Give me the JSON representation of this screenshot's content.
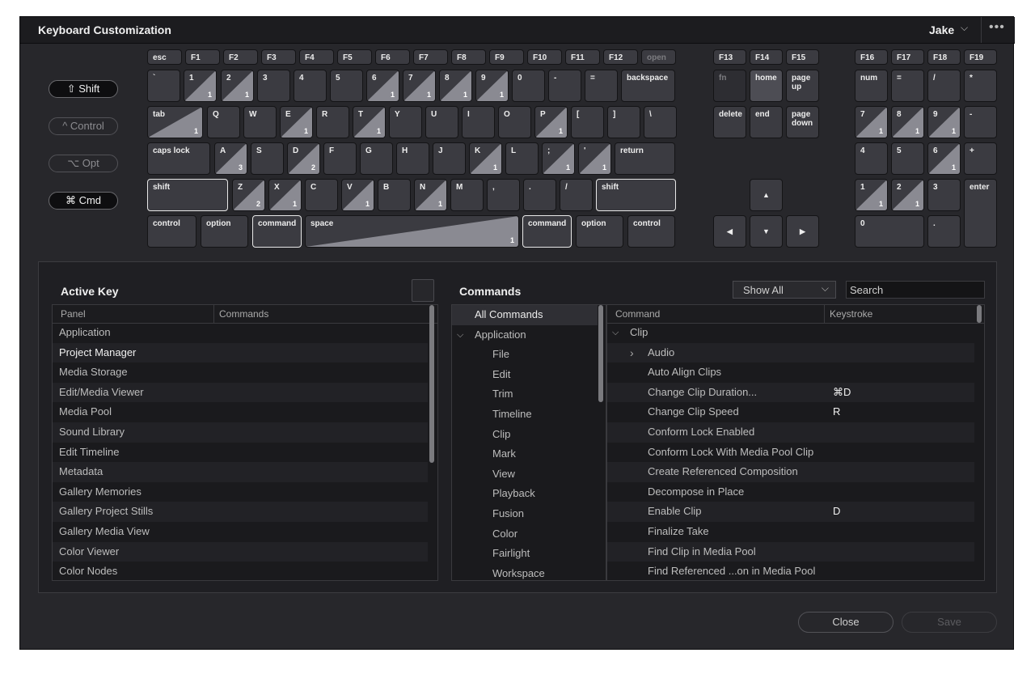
{
  "window": {
    "title": "Keyboard Customization",
    "user": "Jake",
    "user_chevron": "⌵",
    "more": "•••"
  },
  "modifiers": {
    "shift": "⇧ Shift",
    "control": "^ Control",
    "opt": "⌥ Opt",
    "cmd": "⌘ Cmd"
  },
  "keys": {
    "esc": "esc",
    "F1": "F1",
    "F2": "F2",
    "F3": "F3",
    "F4": "F4",
    "F5": "F5",
    "F6": "F6",
    "F7": "F7",
    "F8": "F8",
    "F9": "F9",
    "F10": "F10",
    "F11": "F11",
    "F12": "F12",
    "open": "open",
    "backtick": "`",
    "k1": "1",
    "k2": "2",
    "k3": "3",
    "k4": "4",
    "k5": "5",
    "k6": "6",
    "k7": "7",
    "k8": "8",
    "k9": "9",
    "k0": "0",
    "minus": "-",
    "equals": "=",
    "backspace": "backspace",
    "tab": "tab",
    "Q": "Q",
    "W": "W",
    "E": "E",
    "R": "R",
    "T": "T",
    "Y": "Y",
    "U": "U",
    "I": "I",
    "O": "O",
    "P": "P",
    "lbracket": "[",
    "rbracket": "]",
    "backslash": "\\",
    "capslock": "caps lock",
    "A": "A",
    "S": "S",
    "D": "D",
    "F": "F",
    "G": "G",
    "H": "H",
    "J": "J",
    "K": "K",
    "L": "L",
    "semicolon": ";",
    "quote": "'",
    "return": "return",
    "lshift": "shift",
    "Z": "Z",
    "X": "X",
    "C": "C",
    "V": "V",
    "B": "B",
    "N": "N",
    "M": "M",
    "comma": ",",
    "period": ".",
    "slash": "/",
    "rshift": "shift",
    "lcontrol": "control",
    "loption": "option",
    "lcommand": "command",
    "space": "space",
    "rcommand": "command",
    "roption": "option",
    "rcontrol": "control",
    "F13": "F13",
    "F14": "F14",
    "F15": "F15",
    "fn": "fn",
    "home": "home",
    "pageup": "page\nup",
    "delete": "delete",
    "end": "end",
    "pagedown": "page\ndown",
    "up": "▲",
    "left": "◀",
    "down": "▼",
    "right": "▶",
    "F16": "F16",
    "F17": "F17",
    "F18": "F18",
    "F19": "F19",
    "num": "num",
    "np_eq": "=",
    "np_div": "/",
    "np_mul": "*",
    "np7": "7",
    "np8": "8",
    "np9": "9",
    "np_minus": "-",
    "np4": "4",
    "np5": "5",
    "np6": "6",
    "np_plus": "+",
    "np1": "1",
    "np2": "2",
    "np3": "3",
    "enter": "enter",
    "np0": "0",
    "np_dot": "."
  },
  "key_counts": {
    "k1": "1",
    "k2": "1",
    "k6": "1",
    "k7": "1",
    "k8": "1",
    "k9": "1",
    "tab": "1",
    "E": "1",
    "T": "1",
    "P": "1",
    "A": "3",
    "D": "2",
    "K": "1",
    "semicolon": "1",
    "quote": "1",
    "Z": "2",
    "X": "1",
    "V": "1",
    "N": "1",
    "space": "1",
    "np7": "1",
    "np8": "1",
    "np9": "1",
    "np6": "1",
    "np1": "1",
    "np2": "1"
  },
  "active_key": {
    "title": "Active Key",
    "columns": [
      "Panel",
      "Commands"
    ],
    "rows": [
      "Application",
      "Project Manager",
      "Media Storage",
      "Edit/Media Viewer",
      "Media Pool",
      "Sound Library",
      "Edit Timeline",
      "Metadata",
      "Gallery Memories",
      "Gallery Project Stills",
      "Gallery Media View",
      "Color Viewer",
      "Color Nodes"
    ]
  },
  "commands": {
    "title": "Commands",
    "filter": "Show All",
    "filter_chevron": "⌵",
    "search_placeholder": "Search",
    "tree": [
      "All Commands",
      "Application",
      "File",
      "Edit",
      "Trim",
      "Timeline",
      "Clip",
      "Mark",
      "View",
      "Playback",
      "Fusion",
      "Color",
      "Fairlight",
      "Workspace"
    ],
    "tree_expander": "⌵",
    "columns": [
      "Command",
      "Keystroke"
    ],
    "rows": [
      {
        "name": "Clip",
        "key": "",
        "expander": "⌵"
      },
      {
        "name": "Audio",
        "key": "",
        "expander": "›"
      },
      {
        "name": "Auto Align Clips",
        "key": ""
      },
      {
        "name": "Change Clip Duration...",
        "key": "⌘D"
      },
      {
        "name": "Change Clip Speed",
        "key": "R"
      },
      {
        "name": "Conform Lock Enabled",
        "key": ""
      },
      {
        "name": "Conform Lock With Media Pool Clip",
        "key": ""
      },
      {
        "name": "Create Referenced Composition",
        "key": ""
      },
      {
        "name": "Decompose in Place",
        "key": ""
      },
      {
        "name": "Enable Clip",
        "key": "D"
      },
      {
        "name": "Finalize Take",
        "key": ""
      },
      {
        "name": "Find Clip in Media Pool",
        "key": ""
      },
      {
        "name": "Find Referenced ...on in Media Pool",
        "key": ""
      }
    ]
  },
  "footer": {
    "close": "Close",
    "save": "Save"
  }
}
